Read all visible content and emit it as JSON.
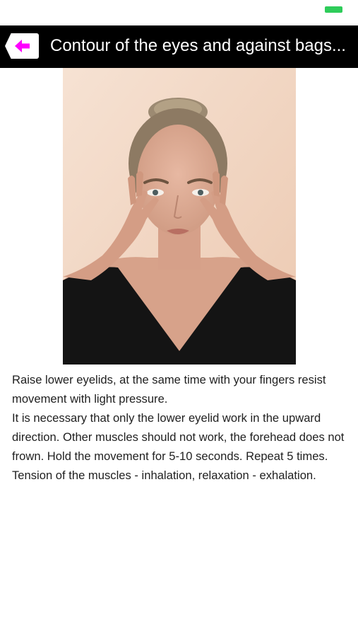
{
  "status_bar": {
    "battery_color": "#2ecc5a"
  },
  "header": {
    "back_icon": "arrow-left-icon",
    "accent_color": "#ff00ff",
    "title": "Contour of the eyes and against bags..."
  },
  "exercise": {
    "photo_alt": "Woman pressing fingers under her eyes",
    "paragraphs": [
      "Raise lower eyelids, at the same time with your fingers resist movement with light pressure.",
      "It is necessary that only the lower eyelid work in the upward direction. Other muscles should not work, the forehead does not frown. Hold the movement for 5-10 seconds. Repeat 5 times.",
      "Tension of the muscles - inhalation, relaxation - exhalation."
    ]
  }
}
